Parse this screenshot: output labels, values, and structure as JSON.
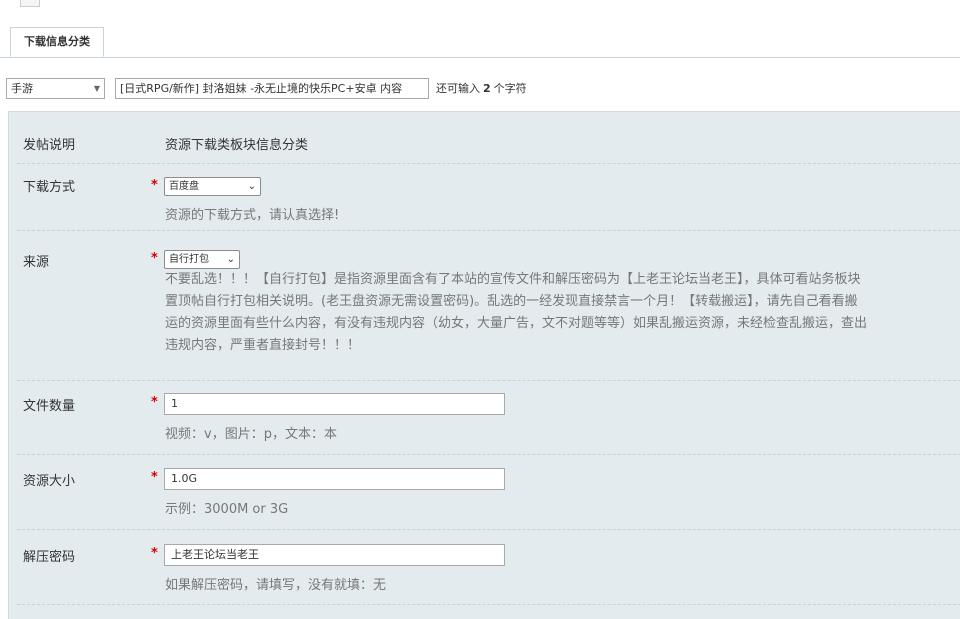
{
  "tabs": [
    {
      "label": "下载信息分类"
    }
  ],
  "title_row": {
    "category_select": "手游",
    "title_value": "[日式RPG/新作] 封洛姐妹 -永无止境的快乐PC+安卓 内容",
    "remain_prefix": "还可输入",
    "remain_count": "2",
    "remain_suffix": "个字符"
  },
  "form": {
    "intro": {
      "label": "发帖说明",
      "value": "资源下载类板块信息分类"
    },
    "download_method": {
      "label": "下载方式",
      "selected": "百度盘",
      "hint": "资源的下载方式，请认真选择!"
    },
    "source": {
      "label": "来源",
      "selected": "自行打包",
      "hint_lines": [
        "不要乱选！！！【自行打包】是指资源里面含有了本站的宣传文件和解压密码为【上老王论坛当老王】，具体可看站务板块",
        "置顶帖自行打包相关说明。(老王盘资源无需设置密码)。乱选的一经发现直接禁言一个月！【转载搬运】，请先自己看看搬",
        "运的资源里面有些什么内容，有没有违规内容（幼女，大量广告，文不对题等等）如果乱搬运资源，未经检查乱搬运，查出",
        "违规内容，严重者直接封号！！！"
      ]
    },
    "file_count": {
      "label": "文件数量",
      "value": "1",
      "hint": "视频：v，图片：p，文本：本"
    },
    "size": {
      "label": "资源大小",
      "value": "1.0G",
      "hint": "示例：3000M or 3G"
    },
    "password": {
      "label": "解压密码",
      "value": "上老王论坛当老王",
      "hint": "如果解压密码，请填写，没有就填：无"
    }
  },
  "required_mark": "*"
}
